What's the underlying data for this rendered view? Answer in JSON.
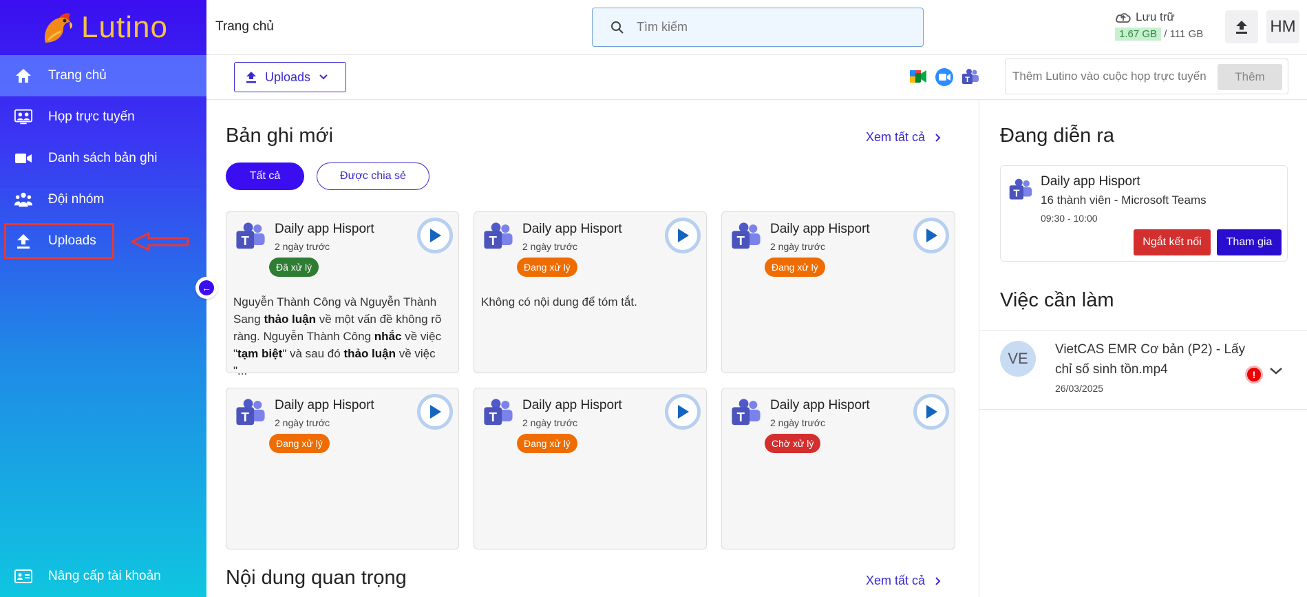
{
  "brand": {
    "name": "Lutino"
  },
  "sidebar": {
    "items": [
      {
        "label": "Trang chủ",
        "icon": "home-icon"
      },
      {
        "label": "Họp trực tuyến",
        "icon": "meeting-icon"
      },
      {
        "label": "Danh sách bản ghi",
        "icon": "video-camera-icon"
      },
      {
        "label": "Đội nhóm",
        "icon": "team-icon"
      },
      {
        "label": "Uploads",
        "icon": "upload-icon"
      }
    ],
    "bottom": {
      "label": "Nâng cấp tài khoản",
      "icon": "id-card-icon"
    }
  },
  "header": {
    "title": "Trang chủ",
    "search_placeholder": "Tìm kiếm",
    "storage_label": "Lưu trữ",
    "storage_used": "1.67 GB",
    "storage_total": "/ 111 GB",
    "avatar_initials": "HM"
  },
  "toolbar": {
    "uploads_label": "Uploads",
    "meet_placeholder": "Thêm Lutino vào cuộc họp trực tuyến",
    "meet_add": "Thêm"
  },
  "recordings": {
    "title": "Bản ghi mới",
    "see_all": "Xem tất cả",
    "filters": [
      "Tất cả",
      "Được chia sẻ"
    ],
    "cards": [
      {
        "title": "Daily app Hisport",
        "time": "2 ngày trước",
        "status": "Đã xử lý",
        "status_color": "#2e7d32",
        "summary": "Nguyễn Thành Công và Nguyễn Thành Sang <b>thảo luận</b> về một vấn đề không rõ ràng. Nguyễn Thành Công <b>nhắc</b> về việc \"<b>tạm biệt</b>\" và sau đó <b>thảo luận</b> về việc \"..."
      },
      {
        "title": "Daily app Hisport",
        "time": "2 ngày trước",
        "status": "Đang xử lý",
        "status_color": "#ef6c00",
        "summary": "Không có nội dung để tóm tắt."
      },
      {
        "title": "Daily app Hisport",
        "time": "2 ngày trước",
        "status": "Đang xử lý",
        "status_color": "#ef6c00",
        "summary": ""
      },
      {
        "title": "Daily app Hisport",
        "time": "2 ngày trước",
        "status": "Đang xử lý",
        "status_color": "#ef6c00",
        "summary": ""
      },
      {
        "title": "Daily app Hisport",
        "time": "2 ngày trước",
        "status": "Đang xử lý",
        "status_color": "#ef6c00",
        "summary": ""
      },
      {
        "title": "Daily app Hisport",
        "time": "2 ngày trước",
        "status": "Chờ xử lý",
        "status_color": "#d32f2f",
        "summary": ""
      }
    ]
  },
  "important": {
    "title": "Nội dung quan trọng",
    "see_all": "Xem tất cả"
  },
  "live": {
    "title": "Đang diễn ra",
    "card": {
      "title": "Daily app Hisport",
      "members": "16 thành viên - Microsoft Teams",
      "time": "09:30 - 10:00",
      "disconnect": "Ngắt kết nối",
      "join": "Tham gia"
    }
  },
  "todo": {
    "title": "Việc cần làm",
    "item": {
      "avatar": "VE",
      "title": "VietCAS EMR Cơ bản (P2) - Lấy chỉ số sinh tồn.mp4",
      "date": "26/03/2025"
    }
  },
  "colors": {
    "accent": "#3a0ef0",
    "link": "#3a2ad0"
  }
}
